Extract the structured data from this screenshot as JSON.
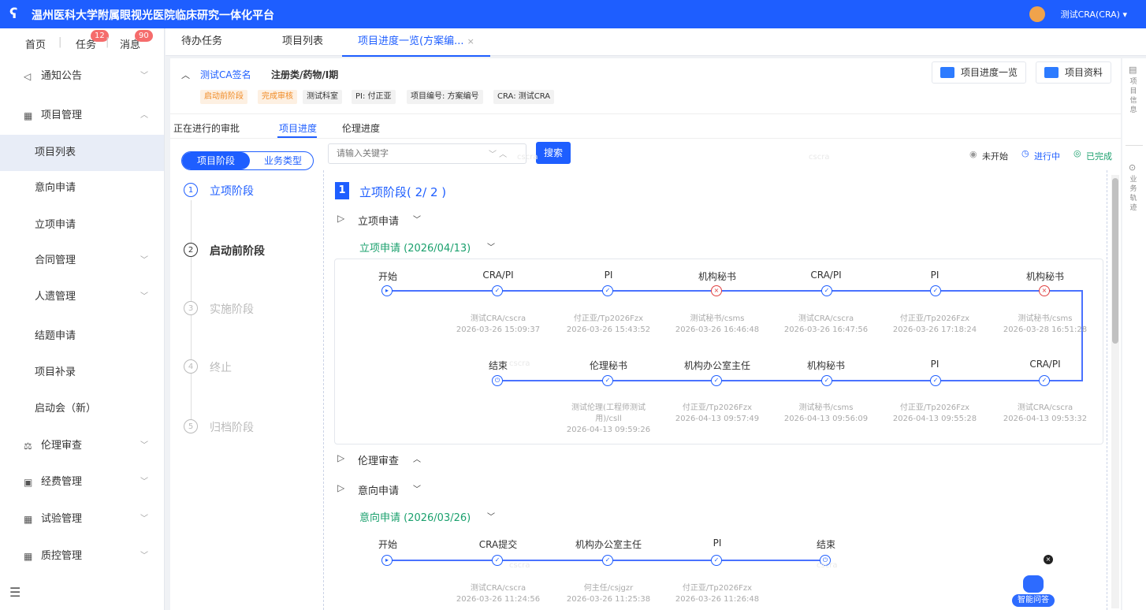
{
  "app": {
    "title": "温州医科大学附属眼视光医院临床研究一体化平台",
    "user": "测试CRA(CRA)"
  },
  "topnav": {
    "home": "首页",
    "tasks": "任务",
    "tasks_badge": "12",
    "messages": "消息",
    "messages_badge": "90"
  },
  "sidebar": {
    "items": [
      {
        "label": "通知公告",
        "icon": "megaphone-icon"
      },
      {
        "label": "项目管理",
        "icon": "grid-icon"
      },
      {
        "label": "项目列表"
      },
      {
        "label": "意向申请"
      },
      {
        "label": "立项申请"
      },
      {
        "label": "合同管理"
      },
      {
        "label": "人遗管理"
      },
      {
        "label": "结题申请"
      },
      {
        "label": "项目补录"
      },
      {
        "label": "启动会（新）"
      },
      {
        "label": "伦理审查",
        "icon": "scale-icon"
      },
      {
        "label": "经费管理",
        "icon": "wallet-icon"
      },
      {
        "label": "试验管理",
        "icon": "grid-icon"
      },
      {
        "label": "质控管理",
        "icon": "grid-icon"
      }
    ]
  },
  "tabs": {
    "t1": "待办任务",
    "t2": "项目列表",
    "t3": "项目进度一览(方案编...",
    "close": "×"
  },
  "project": {
    "name": "测试CA签名",
    "type": "注册类/药物/I期",
    "tags": {
      "stage": "启动前阶段",
      "review": "完成审核",
      "dept": "测试科室",
      "pi": "PI: 付正亚",
      "code": "项目编号: 方案编号",
      "cra": "CRA: 测试CRA"
    },
    "btn_progress": "项目进度一览",
    "btn_docs": "项目资料"
  },
  "subtabs": {
    "s1": "正在进行的审批",
    "s2": "项目进度",
    "s3": "伦理进度"
  },
  "toggle": {
    "a": "项目阶段",
    "b": "业务类型"
  },
  "search": {
    "placeholder": "请输入关键字",
    "button": "搜索"
  },
  "legend": {
    "not_started": "未开始",
    "in_progress": "进行中",
    "done": "已完成"
  },
  "stages": [
    {
      "num": "1",
      "label": "立项阶段"
    },
    {
      "num": "2",
      "label": "启动前阶段"
    },
    {
      "num": "3",
      "label": "实施阶段"
    },
    {
      "num": "4",
      "label": "终止"
    },
    {
      "num": "5",
      "label": "归档阶段"
    }
  ],
  "stage_header": {
    "num": "1",
    "title": "立项阶段( 2/ 2 )"
  },
  "sections": {
    "lixiang": "立项申请",
    "lixiang_sub": "立项申请 (2026/04/13)",
    "lunli": "伦理审查",
    "yixiang": "意向申请",
    "yixiang_sub": "意向申请 (2026/03/26)"
  },
  "flow1_row1": [
    {
      "role": "开始",
      "who": "",
      "time": ""
    },
    {
      "role": "CRA/PI",
      "who": "测试CRA/cscra",
      "time": "2026-03-26 15:09:37"
    },
    {
      "role": "PI",
      "who": "付正亚/Tp2026Fzx",
      "time": "2026-03-26 15:43:52"
    },
    {
      "role": "机构秘书",
      "who": "测试秘书/csms",
      "time": "2026-03-26 16:46:48"
    },
    {
      "role": "CRA/PI",
      "who": "测试CRA/cscra",
      "time": "2026-03-26 16:47:56"
    },
    {
      "role": "PI",
      "who": "付正亚/Tp2026Fzx",
      "time": "2026-03-26 17:18:24"
    },
    {
      "role": "机构秘书",
      "who": "测试秘书/csms",
      "time": "2026-03-28 16:51:28"
    }
  ],
  "flow1_row2": [
    {
      "role": "结束",
      "who": "",
      "who2": "",
      "time": ""
    },
    {
      "role": "伦理秘书",
      "who": "测试伦理(工程师测试",
      "who2": "用)/csll",
      "time": "2026-04-13 09:59:26"
    },
    {
      "role": "机构办公室主任",
      "who": "付正亚/Tp2026Fzx",
      "who2": "",
      "time": "2026-04-13 09:57:49"
    },
    {
      "role": "机构秘书",
      "who": "测试秘书/csms",
      "who2": "",
      "time": "2026-04-13 09:56:09"
    },
    {
      "role": "PI",
      "who": "付正亚/Tp2026Fzx",
      "who2": "",
      "time": "2026-04-13 09:55:28"
    },
    {
      "role": "CRA/PI",
      "who": "测试CRA/cscra",
      "who2": "",
      "time": "2026-04-13 09:53:32"
    }
  ],
  "flow2": [
    {
      "role": "开始",
      "who": "",
      "time": ""
    },
    {
      "role": "CRA提交",
      "who": "测试CRA/cscra",
      "time": "2026-03-26 11:24:56"
    },
    {
      "role": "机构办公室主任",
      "who": "何主任/csjgzr",
      "time": "2026-03-26 11:25:38"
    },
    {
      "role": "PI",
      "who": "付正亚/Tp2026Fzx",
      "time": "2026-03-26 11:26:48"
    },
    {
      "role": "结束",
      "who": "",
      "time": ""
    }
  ],
  "rail": {
    "info": "项目信息",
    "track": "业务轨迹"
  },
  "assistant": "智能问答",
  "watermark": "cscra"
}
